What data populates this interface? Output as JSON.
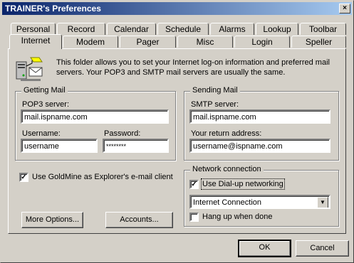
{
  "window": {
    "title": "TRAINER's Preferences",
    "close_glyph": "×"
  },
  "tabs": {
    "row1": [
      "Personal",
      "Record",
      "Calendar",
      "Schedule",
      "Alarms",
      "Lookup",
      "Toolbar"
    ],
    "row2": [
      "Internet",
      "Modem",
      "Pager",
      "Misc",
      "Login",
      "Speller"
    ],
    "active": "Internet"
  },
  "info": {
    "icon": "mail-server-icon",
    "text": "This folder allows you to set your Internet log-on information and preferred mail servers. Your POP3 and SMTP mail servers are usually the same."
  },
  "getting_mail": {
    "title": "Getting Mail",
    "pop3_label": "POP3 server:",
    "pop3_value": "mail.ispname.com",
    "username_label": "Username:",
    "username_value": "username",
    "password_label": "Password:",
    "password_value": "********"
  },
  "sending_mail": {
    "title": "Sending Mail",
    "smtp_label": "SMTP server:",
    "smtp_value": "mail.ispname.com",
    "return_label": "Your return address:",
    "return_value": "username@ispname.com"
  },
  "explorer_client": {
    "label": "Use GoldMine as Explorer's e-mail client",
    "checked": true
  },
  "network": {
    "title": "Network connection",
    "dialup_label": "Use Dial-up networking",
    "dialup_checked": true,
    "connection_value": "Internet Connection",
    "hangup_label": "Hang up when done",
    "hangup_checked": false
  },
  "buttons": {
    "more_options": "More Options...",
    "accounts": "Accounts...",
    "ok": "OK",
    "cancel": "Cancel"
  },
  "check_glyph": "✓",
  "dropdown_glyph": "▼"
}
